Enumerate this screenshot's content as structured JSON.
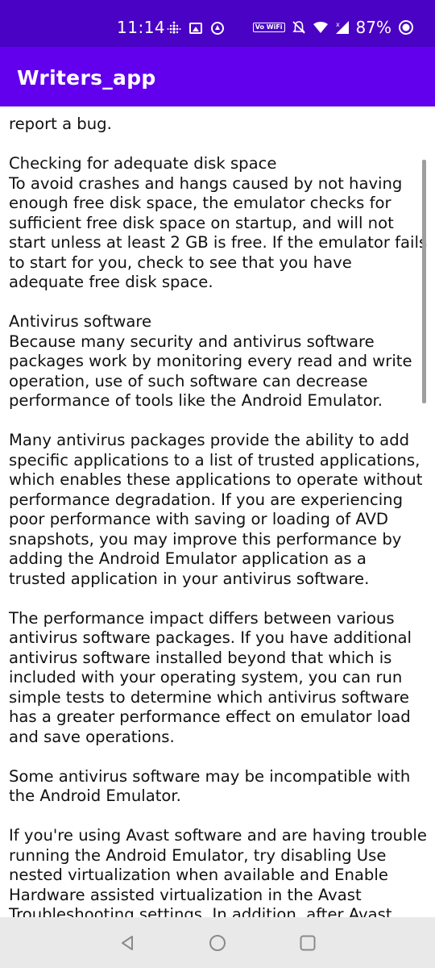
{
  "status_bar": {
    "time": "11:14",
    "vowifi_label": "Vo WiFi",
    "battery_percent": "87%",
    "icons": [
      "fitbit-dots-icon",
      "gallery-icon",
      "circle-sync-icon",
      "vowifi-icon",
      "bell-muted-icon",
      "wifi-icon",
      "signal-icon",
      "battery-icon"
    ]
  },
  "app_bar": {
    "title": "Writers_app",
    "color": "#6200ee"
  },
  "content": {
    "paragraphs": [
      "report a bug.",
      "Checking for adequate disk space\nTo avoid crashes and hangs caused by not having enough free disk space, the emulator checks for sufficient free disk space on startup, and will not start unless at least 2 GB is free. If the emulator fails to start for you, check to see that you have adequate free disk space.",
      "Antivirus software\nBecause many security and antivirus software packages work by monitoring every read and write operation, use of such software can decrease performance of tools like the Android Emulator.",
      "Many antivirus packages provide the ability to add specific applications to a list of trusted applications, which enables these applications to operate without performance degradation. If you are experiencing poor performance with saving or loading of AVD snapshots, you may improve this performance by adding the Android Emulator application as a trusted application in your antivirus software.",
      "The performance impact differs between various antivirus software packages. If you have additional antivirus software installed beyond that which is included with your operating system, you can run simple tests to determine which antivirus software has a greater performance effect on emulator load and save operations.",
      "Some antivirus software may be incompatible with the Android Emulator.",
      "If you're using Avast software and are having trouble running the Android Emulator, try disabling Use nested virtualization when available and Enable Hardware assisted virtualization in the Avast Troubleshooting settings. In addition, after Avast hardware"
    ]
  },
  "nav_bar": {
    "buttons": [
      "back-icon",
      "home-icon",
      "recents-icon"
    ]
  }
}
